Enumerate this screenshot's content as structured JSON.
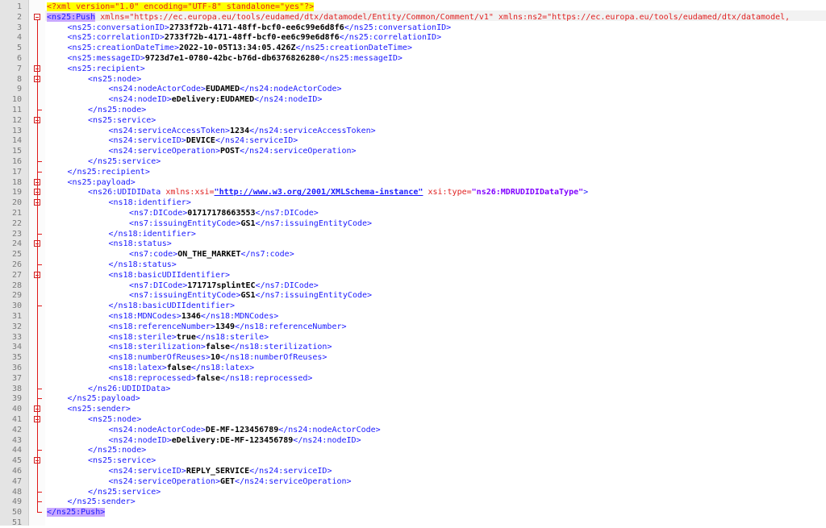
{
  "editor": {
    "lines": [
      {
        "num": "1",
        "indent": 0,
        "kind": "pi",
        "text": "<?xml version=\"1.0\" encoding=\"UTF-8\" standalone=\"yes\"?>"
      },
      {
        "num": "2",
        "indent": 0,
        "kind": "root",
        "text": "<ns25:Push",
        "attrs": " xmlns=\"https://ec.europa.eu/tools/eudamed/dtx/datamodel/Entity/Common/Comment/v1\" xmlns:ns2=\"https://ec.europa.eu/tools/eudamed/dtx/datamodel,"
      },
      {
        "num": "3",
        "indent": 1,
        "kind": "el",
        "open": "<ns25:conversationID>",
        "val": "2733f72b-4171-48ff-bcf0-ee6c99e6d8f6",
        "close": "</ns25:conversationID>"
      },
      {
        "num": "4",
        "indent": 1,
        "kind": "el",
        "open": "<ns25:correlationID>",
        "val": "2733f72b-4171-48ff-bcf0-ee6c99e6d8f6",
        "close": "</ns25:correlationID>"
      },
      {
        "num": "5",
        "indent": 1,
        "kind": "el",
        "open": "<ns25:creationDateTime>",
        "val": "2022-10-05T13:34:05.426Z",
        "close": "</ns25:creationDateTime>"
      },
      {
        "num": "6",
        "indent": 1,
        "kind": "el",
        "open": "<ns25:messageID>",
        "val": "9723d7e1-0780-42bc-b76d-db6376826280",
        "close": "</ns25:messageID>"
      },
      {
        "num": "7",
        "indent": 1,
        "kind": "tag",
        "open": "<ns25:recipient>"
      },
      {
        "num": "8",
        "indent": 2,
        "kind": "tag",
        "open": "<ns25:node>"
      },
      {
        "num": "9",
        "indent": 3,
        "kind": "el",
        "open": "<ns24:nodeActorCode>",
        "val": "EUDAMED",
        "close": "</ns24:nodeActorCode>"
      },
      {
        "num": "10",
        "indent": 3,
        "kind": "el",
        "open": "<ns24:nodeID>",
        "val": "eDelivery:EUDAMED",
        "close": "</ns24:nodeID>"
      },
      {
        "num": "11",
        "indent": 2,
        "kind": "tag",
        "open": "</ns25:node>"
      },
      {
        "num": "12",
        "indent": 2,
        "kind": "tag",
        "open": "<ns25:service>"
      },
      {
        "num": "13",
        "indent": 3,
        "kind": "el",
        "open": "<ns24:serviceAccessToken>",
        "val": "1234",
        "close": "</ns24:serviceAccessToken>"
      },
      {
        "num": "14",
        "indent": 3,
        "kind": "el",
        "open": "<ns24:serviceID>",
        "val": "DEVICE",
        "close": "</ns24:serviceID>"
      },
      {
        "num": "15",
        "indent": 3,
        "kind": "el",
        "open": "<ns24:serviceOperation>",
        "val": "POST",
        "close": "</ns24:serviceOperation>"
      },
      {
        "num": "16",
        "indent": 2,
        "kind": "tag",
        "open": "</ns25:service>"
      },
      {
        "num": "17",
        "indent": 1,
        "kind": "tag",
        "open": "</ns25:recipient>"
      },
      {
        "num": "18",
        "indent": 1,
        "kind": "tag",
        "open": "<ns25:payload>"
      },
      {
        "num": "19",
        "indent": 2,
        "kind": "udi",
        "open": "<ns26:UDIDIData",
        "a1": " xmlns:xsi=",
        "s1": "\"http://www.w3.org/2001/XMLSchema-instance\"",
        "a2": " xsi:type=",
        "s2": "\"ns26:MDRUDIDIDataType\"",
        "close": ">"
      },
      {
        "num": "20",
        "indent": 3,
        "kind": "tag",
        "open": "<ns18:identifier>"
      },
      {
        "num": "21",
        "indent": 4,
        "kind": "el",
        "open": "<ns7:DICode>",
        "val": "01717178663553",
        "close": "</ns7:DICode>"
      },
      {
        "num": "22",
        "indent": 4,
        "kind": "el",
        "open": "<ns7:issuingEntityCode>",
        "val": "GS1",
        "close": "</ns7:issuingEntityCode>"
      },
      {
        "num": "23",
        "indent": 3,
        "kind": "tag",
        "open": "</ns18:identifier>"
      },
      {
        "num": "24",
        "indent": 3,
        "kind": "tag",
        "open": "<ns18:status>"
      },
      {
        "num": "25",
        "indent": 4,
        "kind": "el",
        "open": "<ns7:code>",
        "val": "ON_THE_MARKET",
        "close": "</ns7:code>"
      },
      {
        "num": "26",
        "indent": 3,
        "kind": "tag",
        "open": "</ns18:status>"
      },
      {
        "num": "27",
        "indent": 3,
        "kind": "tag",
        "open": "<ns18:basicUDIIdentifier>"
      },
      {
        "num": "28",
        "indent": 4,
        "kind": "el",
        "open": "<ns7:DICode>",
        "val": "171717splintEC",
        "close": "</ns7:DICode>"
      },
      {
        "num": "29",
        "indent": 4,
        "kind": "el",
        "open": "<ns7:issuingEntityCode>",
        "val": "GS1",
        "close": "</ns7:issuingEntityCode>"
      },
      {
        "num": "30",
        "indent": 3,
        "kind": "tag",
        "open": "</ns18:basicUDIIdentifier>"
      },
      {
        "num": "31",
        "indent": 3,
        "kind": "el",
        "open": "<ns18:MDNCodes>",
        "val": "1346",
        "close": "</ns18:MDNCodes>"
      },
      {
        "num": "32",
        "indent": 3,
        "kind": "el",
        "open": "<ns18:referenceNumber>",
        "val": "1349",
        "close": "</ns18:referenceNumber>"
      },
      {
        "num": "33",
        "indent": 3,
        "kind": "el",
        "open": "<ns18:sterile>",
        "val": "true",
        "close": "</ns18:sterile>"
      },
      {
        "num": "34",
        "indent": 3,
        "kind": "el",
        "open": "<ns18:sterilization>",
        "val": "false",
        "close": "</ns18:sterilization>"
      },
      {
        "num": "35",
        "indent": 3,
        "kind": "el",
        "open": "<ns18:numberOfReuses>",
        "val": "10",
        "close": "</ns18:numberOfReuses>"
      },
      {
        "num": "36",
        "indent": 3,
        "kind": "el",
        "open": "<ns18:latex>",
        "val": "false",
        "close": "</ns18:latex>"
      },
      {
        "num": "37",
        "indent": 3,
        "kind": "el",
        "open": "<ns18:reprocessed>",
        "val": "false",
        "close": "</ns18:reprocessed>"
      },
      {
        "num": "38",
        "indent": 2,
        "kind": "tag",
        "open": "</ns26:UDIDIData>"
      },
      {
        "num": "39",
        "indent": 1,
        "kind": "tag",
        "open": "</ns25:payload>"
      },
      {
        "num": "40",
        "indent": 1,
        "kind": "tag",
        "open": "<ns25:sender>"
      },
      {
        "num": "41",
        "indent": 2,
        "kind": "tag",
        "open": "<ns25:node>"
      },
      {
        "num": "42",
        "indent": 3,
        "kind": "el",
        "open": "<ns24:nodeActorCode>",
        "val": "DE-MF-123456789",
        "close": "</ns24:nodeActorCode>"
      },
      {
        "num": "43",
        "indent": 3,
        "kind": "el",
        "open": "<ns24:nodeID>",
        "val": "eDelivery:DE-MF-123456789",
        "close": "</ns24:nodeID>"
      },
      {
        "num": "44",
        "indent": 2,
        "kind": "tag",
        "open": "</ns25:node>"
      },
      {
        "num": "45",
        "indent": 2,
        "kind": "tag",
        "open": "<ns25:service>"
      },
      {
        "num": "46",
        "indent": 3,
        "kind": "el",
        "open": "<ns24:serviceID>",
        "val": "REPLY_SERVICE",
        "close": "</ns24:serviceID>"
      },
      {
        "num": "47",
        "indent": 3,
        "kind": "el",
        "open": "<ns24:serviceOperation>",
        "val": "GET",
        "close": "</ns24:serviceOperation>"
      },
      {
        "num": "48",
        "indent": 2,
        "kind": "tag",
        "open": "</ns25:service>"
      },
      {
        "num": "49",
        "indent": 1,
        "kind": "tag",
        "open": "</ns25:sender>"
      },
      {
        "num": "50",
        "indent": 0,
        "kind": "endroot",
        "open": "</ns25:Push>"
      },
      {
        "num": "51",
        "indent": 0,
        "kind": "empty"
      }
    ]
  }
}
